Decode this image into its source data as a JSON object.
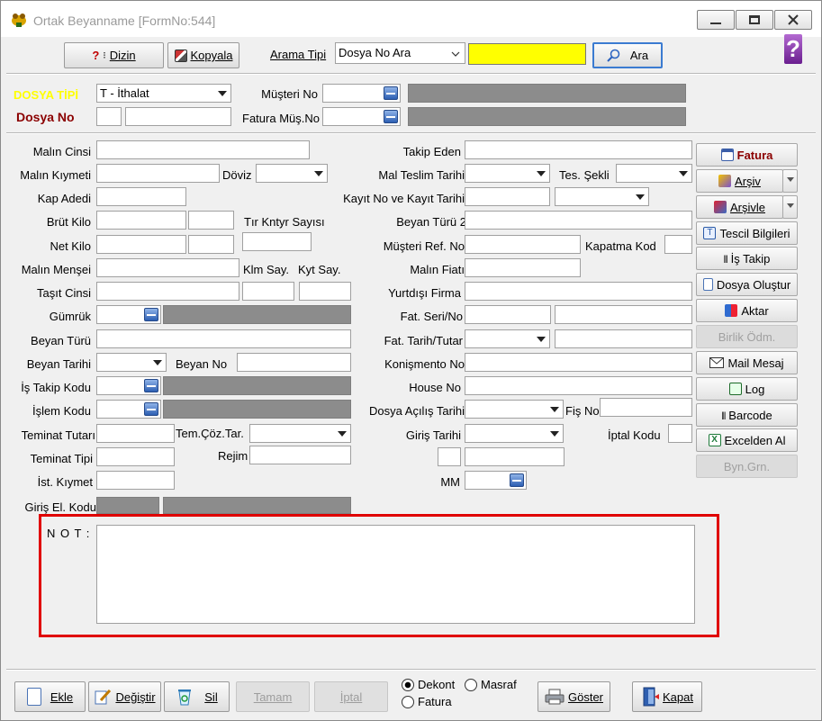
{
  "window": {
    "title": "Ortak Beyanname [FormNo:544]",
    "controls": [
      "minimize",
      "maximize",
      "close"
    ]
  },
  "toolbar": {
    "dizin_label": "Dizin",
    "kopyala_label": "Kopyala",
    "arama_tipi_label": "Arama Tipi",
    "arama_tipi_value": "Dosya No Ara",
    "search_value": "",
    "ara_label": "Ara",
    "search_highlight": "#ffff00"
  },
  "header": {
    "dosya_tipi_label": "DOSYA TİPİ",
    "dosya_tipi_value": "T - İthalat",
    "dosya_no_label": "Dosya No",
    "musteri_no_label": "Müşteri No",
    "fatura_mus_no_label": "Fatura Müş.No",
    "accent_yellow": "#ffff00",
    "accent_red": "#8b0000"
  },
  "left": {
    "malin_cinsi": "Malın Cinsi",
    "malin_kiymeti": "Malın Kıymeti",
    "doviz": "Döviz",
    "kap_adedi": "Kap Adedi",
    "brut_kilo": "Brüt Kilo",
    "tir_kntyr": "Tır Kntyr Sayısı",
    "net_kilo": "Net Kilo",
    "malin_mensei": "Malın Menşei",
    "klm_say": "Klm Say.",
    "kyt_say": "Kyt Say.",
    "tasit_cinsi": "Taşıt Cinsi",
    "gumruk": "Gümrük",
    "beyan_turu": "Beyan Türü",
    "beyan_tarihi": "Beyan Tarihi",
    "beyan_no": "Beyan No",
    "is_takip_kodu": "İş Takip Kodu",
    "islem_kodu": "İşlem Kodu",
    "teminat_tutari": "Teminat Tutarı",
    "tem_coz_tar": "Tem.Çöz.Tar.",
    "teminat_tipi": "Teminat Tipi",
    "rejim": "Rejim",
    "ist_kiymet": "İst. Kıymet",
    "giris_el_kodu": "Giriş El. Kodu"
  },
  "right": {
    "takip_eden": "Takip Eden",
    "mal_teslim_tarihi": "Mal Teslim Tarihi",
    "tes_sekli": "Tes. Şekli",
    "kayit_no_tarihi": "Kayıt  No  ve Kayıt Tarihi",
    "beyan_turu_2": "Beyan Türü 2",
    "musteri_ref_no": "Müşteri  Ref. No",
    "kapatma_kod": "Kapatma Kod",
    "malin_fiati": "Malın Fiatı",
    "yurtdisi_firma": "Yurtdışı Firma",
    "fat_seri_no": "Fat. Seri/No",
    "fat_tarih_tutar": "Fat. Tarih/Tutar",
    "konismento_no": "Konişmento No",
    "house_no": "House No",
    "dosya_acilis_tarihi": "Dosya Açılış Tarihi",
    "fis_no": "Fiş No",
    "giris_tarihi": "Giriş Tarihi",
    "iptal_kodu": "İptal Kodu",
    "mm": "MM"
  },
  "side_buttons": [
    {
      "name": "fatura",
      "label": "Fatura"
    },
    {
      "name": "arsiv",
      "label": "Arşiv"
    },
    {
      "name": "arsivle",
      "label": "Arşivle"
    },
    {
      "name": "tescil-bilgileri",
      "label": "Tescil Bilgileri"
    },
    {
      "name": "is-takip",
      "label": "İş Takip"
    },
    {
      "name": "dosya-olustur",
      "label": "Dosya Oluştur"
    },
    {
      "name": "aktar",
      "label": "Aktar"
    },
    {
      "name": "birlik-odm",
      "label": "Birlik Ödm."
    },
    {
      "name": "mail-mesaj",
      "label": "Mail Mesaj"
    },
    {
      "name": "log",
      "label": "Log"
    },
    {
      "name": "barcode",
      "label": "Barcode"
    },
    {
      "name": "excelden-al",
      "label": "Excelden Al"
    },
    {
      "name": "byn-grn",
      "label": "Byn.Grn."
    }
  ],
  "note": {
    "label": "N O T :",
    "highlight_color": "#e00000"
  },
  "bottom": {
    "ekle": "Ekle",
    "degistir": "Değiştir",
    "sil": "Sil",
    "tamam": "Tamam",
    "iptal": "İptal",
    "dekont": "Dekont",
    "masraf": "Masraf",
    "fatura": "Fatura",
    "goster": "Göster",
    "kapat": "Kapat"
  }
}
